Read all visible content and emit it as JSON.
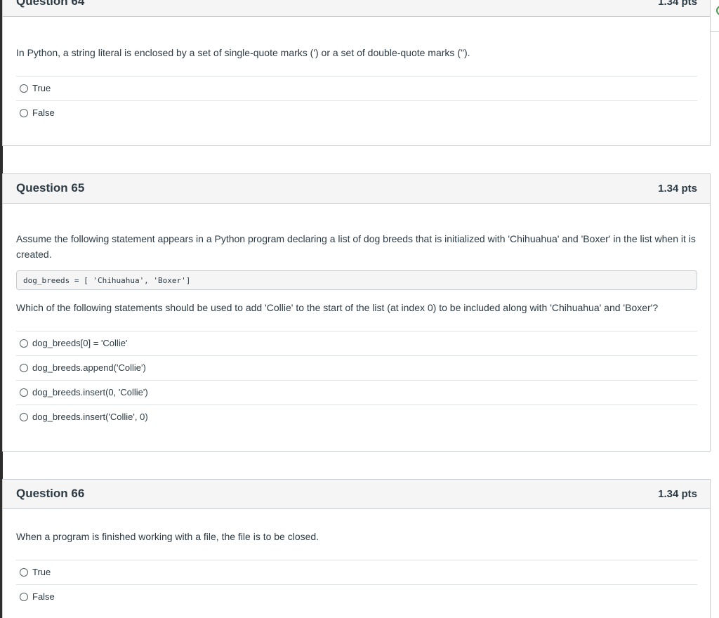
{
  "questions": [
    {
      "title": "Question 64",
      "points": "1.34 pts",
      "prompt": "In Python, a string literal is enclosed by a set of single-quote marks (') or a set of double-quote marks (\").",
      "answers": [
        "True",
        "False"
      ]
    },
    {
      "title": "Question 65",
      "points": "1.34 pts",
      "prompt": "Assume the following statement appears in a Python program declaring a list of dog breeds that is initialized with 'Chihuahua' and 'Boxer' in the list when it is created.",
      "code": "dog_breeds = [ 'Chihuahua', 'Boxer']",
      "prompt2": "Which of the following statements should be used to add 'Collie' to the start of the list (at index 0) to be included along with 'Chihuahua' and 'Boxer'?",
      "answers": [
        "dog_breeds[0] = 'Collie'",
        "dog_breeds.append('Collie')",
        "dog_breeds.insert(0, 'Collie')",
        "dog_breeds.insert('Collie', 0)"
      ]
    },
    {
      "title": "Question 66",
      "points": "1.34 pts",
      "prompt": "When a program is finished working with a file, the file is to be closed.",
      "answers": [
        "True",
        "False"
      ]
    }
  ]
}
